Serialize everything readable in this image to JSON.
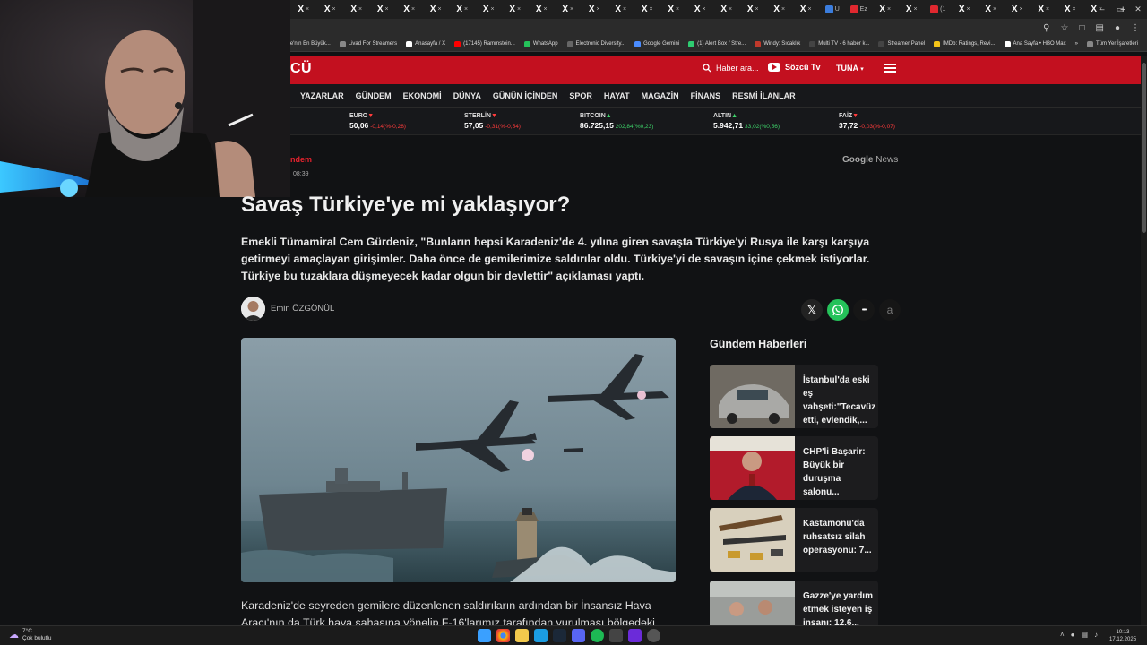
{
  "browser": {
    "tabs": [
      {
        "label": "×",
        "kind": "x"
      },
      {
        "label": "×",
        "kind": "x"
      },
      {
        "label": "×",
        "kind": "x"
      },
      {
        "label": "×",
        "kind": "x"
      },
      {
        "label": "×",
        "kind": "x"
      },
      {
        "label": "×",
        "kind": "x"
      },
      {
        "label": "×",
        "kind": "x"
      },
      {
        "label": "×",
        "kind": "x"
      },
      {
        "label": "×",
        "kind": "x"
      },
      {
        "label": "×",
        "kind": "x"
      },
      {
        "label": "×",
        "kind": "x"
      },
      {
        "label": "×",
        "kind": "x"
      },
      {
        "label": "×",
        "kind": "x"
      },
      {
        "label": "×",
        "kind": "x"
      },
      {
        "label": "×",
        "kind": "x"
      },
      {
        "label": "×",
        "kind": "x"
      },
      {
        "label": "×",
        "kind": "x"
      },
      {
        "label": "×",
        "kind": "x"
      },
      {
        "label": "×",
        "kind": "x"
      },
      {
        "label": "×",
        "kind": "x"
      },
      {
        "label": "U",
        "kind": "fav-blue"
      },
      {
        "label": "Ez",
        "kind": "fav-red"
      },
      {
        "label": "×",
        "kind": "x"
      },
      {
        "label": "×",
        "kind": "x"
      },
      {
        "label": "(1",
        "kind": "fav-red"
      },
      {
        "label": "×",
        "kind": "x"
      },
      {
        "label": "×",
        "kind": "x"
      },
      {
        "label": "×",
        "kind": "x"
      },
      {
        "label": "×",
        "kind": "x"
      },
      {
        "label": "×",
        "kind": "x"
      },
      {
        "label": "×",
        "kind": "x"
      }
    ],
    "new_tab": "+",
    "bookmarks": [
      {
        "label": "ye'nin En Büyük...",
        "color": "#c3101f"
      },
      {
        "label": "Livad For Streamers",
        "color": "#888888"
      },
      {
        "label": "Anasayfa / X",
        "color": "#ffffff"
      },
      {
        "label": "(17145) Rammstein...",
        "color": "#ff0000"
      },
      {
        "label": "WhatsApp",
        "color": "#25c25a"
      },
      {
        "label": "Electronic Diversity...",
        "color": "#666666"
      },
      {
        "label": "Google Gemini",
        "color": "#4a8cff"
      },
      {
        "label": "(1) Alert Box / Stre...",
        "color": "#2ecc71"
      },
      {
        "label": "Windy: Sıcaklık",
        "color": "#c0392b"
      },
      {
        "label": "Multi TV - 6 haber k...",
        "color": "#444444"
      },
      {
        "label": "Streamer Panel",
        "color": "#444444"
      },
      {
        "label": "IMDb: Ratings, Revi...",
        "color": "#f5c518"
      },
      {
        "label": "Ana Sayfa • HBO Max",
        "color": "#ffffff"
      },
      {
        "label": "»",
        "color": ""
      },
      {
        "label": "Tüm Yer İşaretleri",
        "color": "#888888"
      }
    ]
  },
  "site": {
    "logo": "CÜ",
    "search_placeholder": "Haber ara...",
    "tv_label": "Sözcü Tv",
    "user_label": "TUNA",
    "nav": [
      "YAZARLAR",
      "GÜNDEM",
      "EKONOMİ",
      "DÜNYA",
      "GÜNÜN İÇİNDEN",
      "SPOR",
      "HAYAT",
      "MAGAZİN",
      "FİNANS",
      "RESMİ İLANLAR"
    ],
    "ticker": [
      {
        "name": "",
        "value": "",
        "change": "6)",
        "dir": "dn"
      },
      {
        "name": "EURO",
        "value": "50,06",
        "change": "-0,14(%-0,28)",
        "dir": "dn"
      },
      {
        "name": "STERLİN",
        "value": "57,05",
        "change": "-0,31(%-0,54)",
        "dir": "dn"
      },
      {
        "name": "BITCOIN",
        "value": "86.725,15",
        "change": "202,84(%0,23)",
        "dir": "up"
      },
      {
        "name": "ALTIN",
        "value": "5.942,71",
        "change": "33,02(%0,56)",
        "dir": "up"
      },
      {
        "name": "FAİZ",
        "value": "37,72",
        "change": "-0,03(%-0,07)",
        "dir": "dn"
      }
    ]
  },
  "article": {
    "category": "ndem",
    "time": "08:39",
    "google_news": {
      "a": "Google",
      "b": "News"
    },
    "title": "Savaş Türkiye'ye mi yaklaşıyor?",
    "lead": "Emekli Tümamiral Cem Gürdeniz, \"Bunların hepsi Karadeniz'de 4. yılına giren savaşta Türkiye'yi Rusya ile karşı karşıya getirmeyi amaçlayan girişimler. Daha önce de gemilerimize saldırılar oldu. Türkiye'yi de savaşın içine çekmek istiyorlar. Türkiye bu tuzaklara düşmeyecek kadar olgun bir devlettir\" açıklaması yaptı.",
    "author": "Emin ÖZGÖNÜL",
    "share": {
      "x": "𝕏",
      "more": "•••",
      "a": "a"
    },
    "body_line1": "Karadeniz'de seyreden gemilere düzenlenen saldırıların ardından bir İnsansız Hava",
    "body_line2": "Aracı'nın da Türk hava sahasına yönelip F-16'larımız tarafından vurulması bölgedeki"
  },
  "sidebar": {
    "title": "Gündem Haberleri",
    "items": [
      {
        "title": "İstanbul'da eski eş vahşeti:\"Tecavüz etti, evlendik,...",
        "thumb": "car"
      },
      {
        "title": "CHP'li Başarir: Büyük bir duruşma salonu...",
        "thumb": "person"
      },
      {
        "title": "Kastamonu'da ruhsatsız silah operasyonu: 7...",
        "thumb": "guns"
      },
      {
        "title": "Gazze'ye yardım etmek isteyen iş insanı: 12.6...",
        "thumb": "people"
      }
    ]
  },
  "taskbar": {
    "weather_temp": "7°C",
    "weather_desc": "Çok bulutlu",
    "time": "10:13",
    "date": "17.12.2025"
  }
}
